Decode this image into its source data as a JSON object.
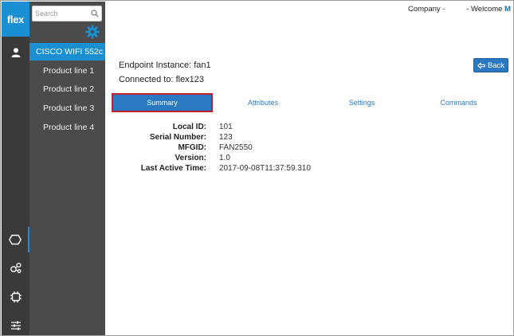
{
  "brand": {
    "logo_text": "flex",
    "accent": "#1a8fd1"
  },
  "rail": {
    "items": [
      {
        "icon": "user-icon"
      },
      {
        "icon": "hexagon-icon",
        "active": true
      },
      {
        "icon": "network-icon"
      },
      {
        "icon": "chip-icon"
      },
      {
        "icon": "sliders-icon"
      }
    ]
  },
  "sidebar": {
    "search_placeholder": "Search",
    "active_item": "CISCO WIFI 552c",
    "items": [
      "Product line 1",
      "Product line 2",
      "Product line 3",
      "Product line 4"
    ]
  },
  "header": {
    "company_label": "Company -",
    "welcome_label": "- Welcome",
    "user_initial": "M"
  },
  "endpoint": {
    "instance_label": "Endpoint Instance:",
    "instance_value": "fan1",
    "connected_label": "Connected to:",
    "connected_value": "flex123",
    "back_label": "Back"
  },
  "tabs": [
    "Summary",
    "Attributes",
    "Settings",
    "Commands"
  ],
  "summary": [
    {
      "key": "Local ID:",
      "value": "101"
    },
    {
      "key": "Serial Number:",
      "value": "123"
    },
    {
      "key": "MFGID:",
      "value": "FAN2550"
    },
    {
      "key": "Version:",
      "value": "1.0"
    },
    {
      "key": "Last Active Time:",
      "value": "2017-09-08T11:37:59.310"
    }
  ],
  "colors": {
    "tab_active": "#2b78c2",
    "tab_active_border": "#c0202a",
    "rail_bg": "#3a3a3a",
    "nav_bg": "#4b4b4b"
  }
}
